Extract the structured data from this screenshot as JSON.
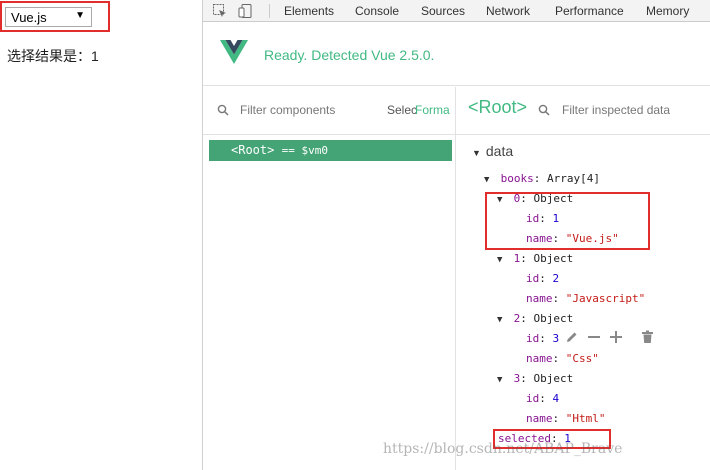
{
  "page": {
    "select": {
      "value": "Vue.js",
      "arrow_icon": "dropdown-triangle-icon"
    },
    "result_label": "选择结果是：",
    "result_value": "1"
  },
  "devtools": {
    "tabs": [
      "Elements",
      "Console",
      "Sources",
      "Network",
      "Performance",
      "Memory"
    ],
    "icons": [
      "inspect-element-icon",
      "device-toggle-icon"
    ],
    "vue": {
      "status": "Ready. Detected Vue 2.5.0.",
      "accent": "#42b983",
      "components_filter_placeholder": "Filter components",
      "select_label": "Selec",
      "format_label": "Forma",
      "inspector_root_label": "<Root>",
      "inspector_filter_placeholder": "Filter inspected data",
      "tree_root_label": "<Root>",
      "tree_root_suffix": "== $vm0",
      "data_heading": "data",
      "books": {
        "key": "books",
        "type": "Array[4]",
        "items": [
          {
            "index": "0",
            "type": "Object",
            "id": "1",
            "name": "\"Vue.js\""
          },
          {
            "index": "1",
            "type": "Object",
            "id": "2",
            "name": "\"Javascript\""
          },
          {
            "index": "2",
            "type": "Object",
            "id": "3",
            "name": "\"Css\""
          },
          {
            "index": "3",
            "type": "Object",
            "id": "4",
            "name": "\"Html\""
          }
        ]
      },
      "selected": {
        "key": "selected",
        "value": "1"
      }
    }
  },
  "watermark": "https://blog.csdn.net/ABAP_Brave",
  "highlight_color": "#e22d2d"
}
